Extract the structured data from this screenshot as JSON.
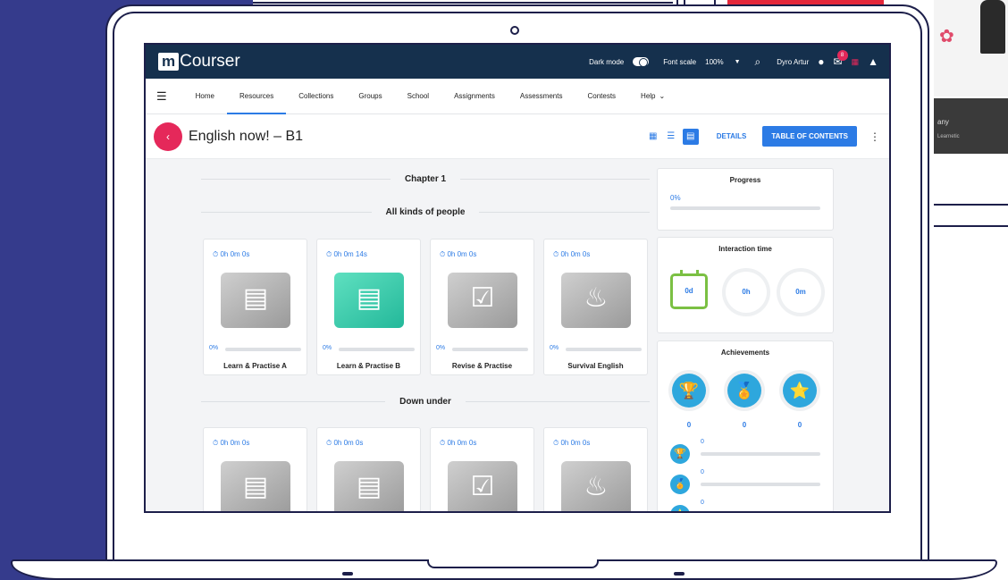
{
  "app": {
    "logo_mark": "m",
    "logo_text": "Courser"
  },
  "topbar": {
    "dark_mode_label": "Dark mode",
    "font_scale_label": "Font scale",
    "zoom_value": "100%",
    "user_name": "Dyro Artur",
    "notification_count": "8"
  },
  "nav": {
    "items": [
      {
        "label": "Home"
      },
      {
        "label": "Resources",
        "active": true
      },
      {
        "label": "Collections"
      },
      {
        "label": "Groups"
      },
      {
        "label": "School"
      },
      {
        "label": "Assignments"
      },
      {
        "label": "Assessments"
      },
      {
        "label": "Contests"
      },
      {
        "label": "Help"
      }
    ]
  },
  "page": {
    "title": "English now! – B1",
    "details_label": "DETAILS",
    "toc_label": "TABLE OF CONTENTS"
  },
  "chapter": {
    "title": "Chapter 1"
  },
  "sections": [
    {
      "title": "All kinds of people",
      "cards": [
        {
          "time": "0h 0m 0s",
          "progress": "0%",
          "label": "Learn & Practise A",
          "icon": "notes-icon"
        },
        {
          "time": "0h 0m 14s",
          "progress": "0%",
          "label": "Learn & Practise B",
          "icon": "notes-icon"
        },
        {
          "time": "0h 0m 0s",
          "progress": "0%",
          "label": "Revise & Practise",
          "icon": "check-magnifier-icon"
        },
        {
          "time": "0h 0m 0s",
          "progress": "0%",
          "label": "Survival English",
          "icon": "flame-icon"
        }
      ]
    },
    {
      "title": "Down under",
      "cards": [
        {
          "time": "0h 0m 0s"
        },
        {
          "time": "0h 0m 0s"
        },
        {
          "time": "0h 0m 0s"
        },
        {
          "time": "0h 0m 0s"
        }
      ]
    }
  ],
  "progress_panel": {
    "title": "Progress",
    "value": "0%"
  },
  "interaction_panel": {
    "title": "Interaction time",
    "days": "0d",
    "hours": "0h",
    "minutes": "0m"
  },
  "achievements_panel": {
    "title": "Achievements",
    "counts": [
      "0",
      "0",
      "0"
    ],
    "list_counts": [
      "0",
      "0",
      "0"
    ]
  },
  "background": {
    "side_text_1": "any",
    "side_text_2": "Learnetic"
  },
  "colors": {
    "topbar": "#15304d",
    "accent": "#2c7be5",
    "back_button": "#e5285a",
    "background_left": "#353b8c"
  }
}
